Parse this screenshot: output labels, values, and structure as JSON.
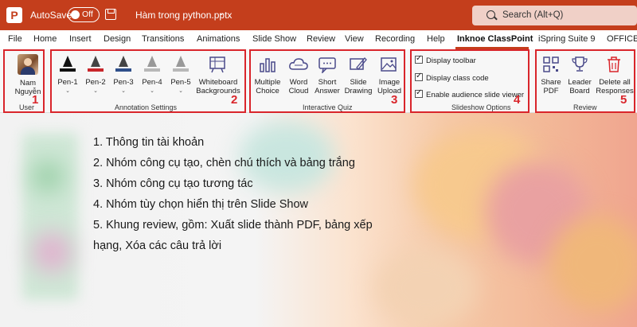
{
  "titlebar": {
    "app_logo": "P",
    "autosave_label": "AutoSave",
    "autosave_state": "Off",
    "file_title": "Hàm trong python.pptx",
    "file_caret": "⌄",
    "search_placeholder": "Search (Alt+Q)"
  },
  "menu": {
    "tabs": [
      "File",
      "Home",
      "Insert",
      "Design",
      "Transitions",
      "Animations",
      "Slide Show",
      "Review",
      "View",
      "Recording",
      "Help",
      "Inknoe ClassPoint",
      "iSpring Suite 9",
      "OFFICE I"
    ],
    "active_tab": "Inknoe ClassPoint"
  },
  "ribbon": {
    "user": {
      "button_line1": "Nam",
      "button_line2": "Nguyễn",
      "group_label": "User",
      "number": "1"
    },
    "annotation": {
      "pens": [
        {
          "label": "Pen-1",
          "color": "#111111"
        },
        {
          "label": "Pen-2",
          "color": "#c8262b"
        },
        {
          "label": "Pen-3",
          "color": "#2f4f8a"
        },
        {
          "label": "Pen-4",
          "color": "#b8b8b8"
        },
        {
          "label": "Pen-5",
          "color": "#b8b8b8"
        }
      ],
      "whiteboard_line1": "Whiteboard",
      "whiteboard_line2": "Backgrounds",
      "group_label": "Annotation Settings",
      "number": "2"
    },
    "quiz": {
      "buttons": [
        {
          "line1": "Multiple",
          "line2": "Choice"
        },
        {
          "line1": "Word",
          "line2": "Cloud"
        },
        {
          "line1": "Short",
          "line2": "Answer"
        },
        {
          "line1": "Slide",
          "line2": "Drawing"
        },
        {
          "line1": "Image",
          "line2": "Upload"
        }
      ],
      "group_label": "Interactive Quiz",
      "number": "3"
    },
    "slideshow": {
      "options": [
        "Display toolbar",
        "Display class code",
        "Enable audience slide viewer"
      ],
      "group_label": "Slideshow Options",
      "number": "4"
    },
    "review": {
      "buttons": [
        {
          "line1": "Share",
          "line2": "PDF"
        },
        {
          "line1": "Leader",
          "line2": "Board"
        },
        {
          "line1": "Delete all",
          "line2": "Responses"
        }
      ],
      "group_label": "Review",
      "number": "5"
    }
  },
  "content": {
    "lines": [
      "1. Thông tin tài khoản",
      "2. Nhóm công cụ tạo, chèn chú thích và bảng trắng",
      "3. Nhóm công cụ tạo tương tác",
      "4. Nhóm tùy chọn hiển thị trên Slide Show",
      "5. Khung review, gồm: Xuất slide thành PDF, bảng xếp",
      "hạng, Xóa các câu trả lời"
    ]
  },
  "colors": {
    "titlebar": "#c43e1c",
    "annotation_border": "#d9252b"
  }
}
